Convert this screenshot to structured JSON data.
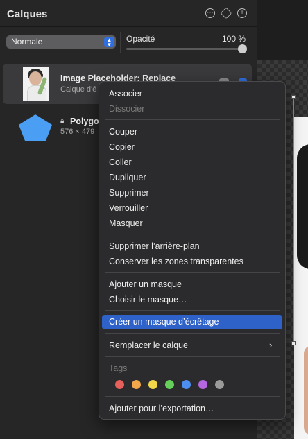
{
  "panel": {
    "title": "Calques",
    "icons": [
      "more-icon",
      "layers-icon",
      "add-icon"
    ],
    "blend_mode": "Normale",
    "opacity_label": "Opacité",
    "opacity_value": "100 %",
    "opacity_fraction": 1.0
  },
  "layers": [
    {
      "name": "Image Placeholder: Replace",
      "subtitle": "Calque d'é"
    },
    {
      "name": "Polygo",
      "subtitle": "576 × 479"
    }
  ],
  "menu": {
    "items": {
      "associer": "Associer",
      "dissocier": "Dissocier",
      "couper": "Couper",
      "copier": "Copier",
      "coller": "Coller",
      "dupliquer": "Dupliquer",
      "supprimer": "Supprimer",
      "verrouiller": "Verrouiller",
      "masquer": "Masquer",
      "supprimer_arriere_plan": "Supprimer l’arrière-plan",
      "conserver_zones": "Conserver les zones transparentes",
      "ajouter_masque": "Ajouter un masque",
      "choisir_masque": "Choisir le masque…",
      "creer_masque_ecretage": "Créer un masque d’écrêtage",
      "remplacer_calque": "Remplacer le calque",
      "tags": "Tags",
      "ajouter_exportation": "Ajouter pour l’exportation…"
    },
    "tag_colors": [
      "#e5605a",
      "#f2a74b",
      "#f2d64a",
      "#66cf5b",
      "#4d8ff0",
      "#b467e0",
      "#9a9a9a"
    ]
  },
  "colors": {
    "accent": "#2f62c9",
    "polygon_fill": "#4a9ff5"
  }
}
